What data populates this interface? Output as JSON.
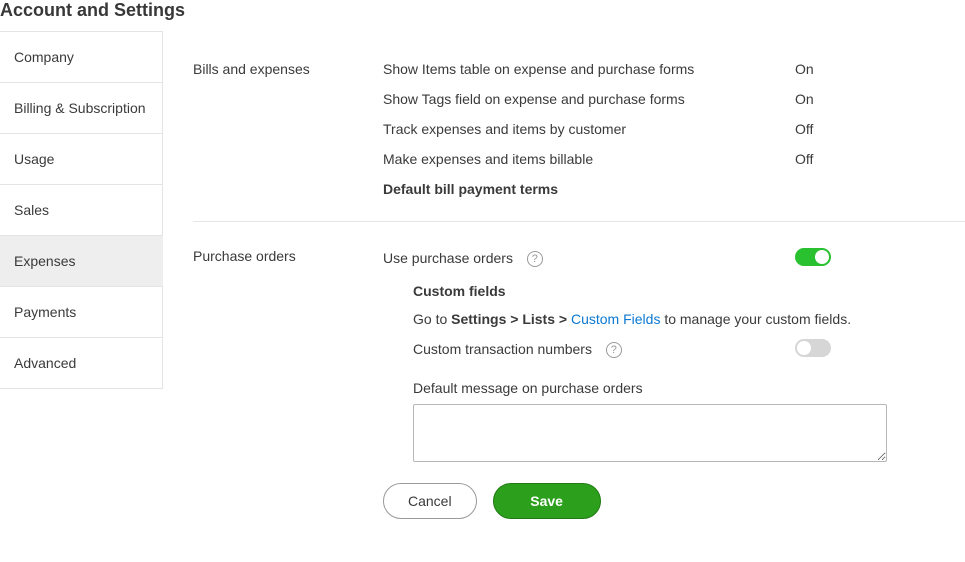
{
  "header": {
    "title": "Account and Settings"
  },
  "sidebar": {
    "items": [
      {
        "label": "Company"
      },
      {
        "label": "Billing & Subscription"
      },
      {
        "label": "Usage"
      },
      {
        "label": "Sales"
      },
      {
        "label": "Expenses"
      },
      {
        "label": "Payments"
      },
      {
        "label": "Advanced"
      }
    ],
    "active_index": 4
  },
  "sections": {
    "bills": {
      "heading": "Bills and expenses",
      "rows": [
        {
          "label": "Show Items table on expense and purchase forms",
          "value": "On"
        },
        {
          "label": "Show Tags field on expense and purchase forms",
          "value": "On"
        },
        {
          "label": "Track expenses and items by customer",
          "value": "Off"
        },
        {
          "label": "Make expenses and items billable",
          "value": "Off"
        }
      ],
      "default_terms_label": "Default bill payment terms"
    },
    "po": {
      "heading": "Purchase orders",
      "use_po_label": "Use purchase orders",
      "use_po_on": true,
      "custom_fields_heading": "Custom fields",
      "custom_fields_text_prefix": "Go to ",
      "custom_fields_path": "Settings > Lists > ",
      "custom_fields_link": "Custom Fields",
      "custom_fields_text_suffix": " to manage your custom fields.",
      "ctn_label": "Custom transaction numbers",
      "ctn_on": false,
      "default_msg_label": "Default message on purchase orders",
      "default_msg_value": ""
    }
  },
  "buttons": {
    "cancel": "Cancel",
    "save": "Save"
  },
  "icons": {
    "help_glyph": "?"
  }
}
